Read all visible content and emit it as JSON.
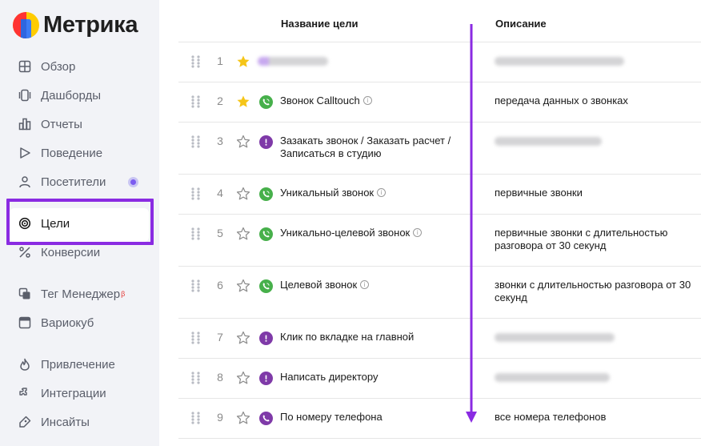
{
  "app": {
    "name": "Метрика"
  },
  "sidebar": {
    "items": [
      {
        "label": "Обзор",
        "icon": "overview-icon"
      },
      {
        "label": "Дашборды",
        "icon": "dashboards-icon"
      },
      {
        "label": "Отчеты",
        "icon": "reports-icon"
      },
      {
        "label": "Поведение",
        "icon": "behavior-icon"
      },
      {
        "label": "Посетители",
        "icon": "visitors-icon",
        "badge": true
      },
      {
        "label": "Цели",
        "icon": "goals-icon",
        "active": true
      },
      {
        "label": "Конверсии",
        "icon": "conversions-icon"
      },
      {
        "label": "Тег Менеджер",
        "icon": "tag-manager-icon",
        "superscript": "β"
      },
      {
        "label": "Вариокуб",
        "icon": "variocube-icon"
      },
      {
        "label": "Привлечение",
        "icon": "acquisition-icon"
      },
      {
        "label": "Интеграции",
        "icon": "integrations-icon"
      },
      {
        "label": "Инсайты",
        "icon": "insights-icon"
      }
    ]
  },
  "table": {
    "headers": {
      "name": "Название цели",
      "description": "Описание"
    },
    "rows": [
      {
        "num": "1",
        "starred": true,
        "type": "blurred",
        "name": "",
        "name_blurred": true,
        "description": "",
        "desc_blurred": true
      },
      {
        "num": "2",
        "starred": true,
        "type": "call",
        "name": "Звонок Calltouch",
        "info": true,
        "description": "передача данных о звонках"
      },
      {
        "num": "3",
        "starred": false,
        "type": "js-event",
        "name": "Зазакать звонок / Заказать расчет / Записаться в студию",
        "description": "",
        "desc_blurred": true
      },
      {
        "num": "4",
        "starred": false,
        "type": "call",
        "name": "Уникальный звонок",
        "info": true,
        "description": "первичные звонки"
      },
      {
        "num": "5",
        "starred": false,
        "type": "call",
        "name": "Уникально-целевой звонок",
        "info": true,
        "description": "первичные звонки с длительностью разговора от 30 секунд"
      },
      {
        "num": "6",
        "starred": false,
        "type": "call",
        "name": "Целевой звонок",
        "info": true,
        "description": "звонки с длительностью разговора от 30 секунд"
      },
      {
        "num": "7",
        "starred": false,
        "type": "js-event",
        "name": "Клик по вкладке на главной",
        "description": "",
        "desc_blurred": true
      },
      {
        "num": "8",
        "starred": false,
        "type": "js-event",
        "name": "Написать директору",
        "description": "",
        "desc_blurred": true
      },
      {
        "num": "9",
        "starred": false,
        "type": "phone",
        "name": "По номеру телефона",
        "description": "все номера телефонов"
      }
    ]
  },
  "colors": {
    "highlight": "#8a2be2",
    "star_active": "#f5c518",
    "call_icon": "#47b04b",
    "event_icon": "#7f3aa8",
    "arrow": "#8a2be2"
  }
}
